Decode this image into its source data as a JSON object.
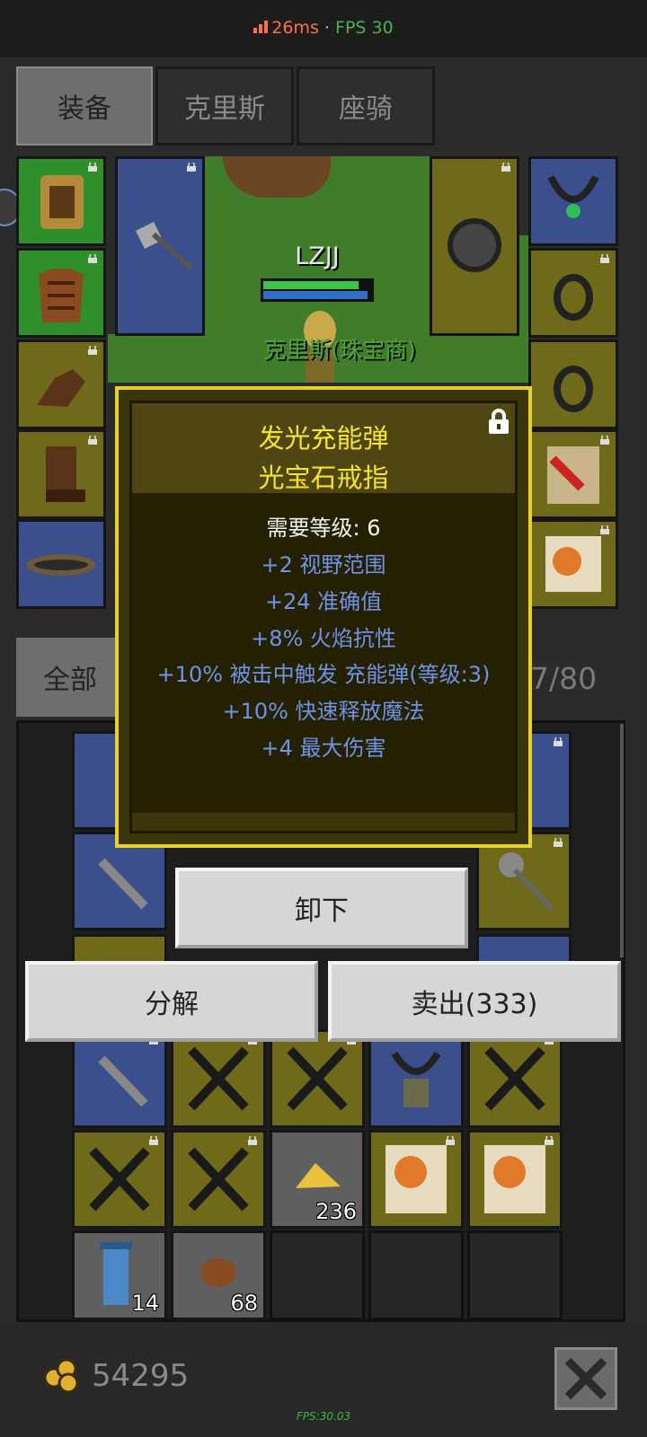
{
  "status_bar": {
    "latency": "26ms",
    "separator": " · ",
    "fps": "FPS 30"
  },
  "tabs": [
    {
      "label": "装备",
      "active": true
    },
    {
      "label": "克里斯",
      "active": false
    },
    {
      "label": "座骑",
      "active": false
    }
  ],
  "character": {
    "name": "LZJJ",
    "npc_label": "克里斯(珠宝商)",
    "hp_fraction": 0.88,
    "mp_fraction": 0.97
  },
  "bag": {
    "filter_label": "全部",
    "capacity_text": "7/80"
  },
  "tooltip": {
    "title_line1": "发光充能弹",
    "title_line2": "光宝石戒指",
    "requirement": "需要等级: 6",
    "stats": [
      "+2 视野范围",
      "+24 准确值",
      "+8% 火焰抗性",
      "+10% 被击中触发 充能弹(等级:3)",
      "+10% 快速释放魔法",
      "+4 最大伤害"
    ],
    "lock_icon": "lock-icon"
  },
  "actions": {
    "unequip": "卸下",
    "decompose": "分解",
    "sell": "卖出(333)"
  },
  "inventory": {
    "gold_nugget_count": "236",
    "scroll_count": "14",
    "meat_count": "68"
  },
  "footer": {
    "gold_amount": "54295",
    "fps_text": "FPS:30.03",
    "close_icon": "close-x-icon"
  },
  "colors": {
    "frame_yellow": "#e8d227",
    "title_yellow": "#f4e42a",
    "stat_blue": "#6e92ea"
  }
}
